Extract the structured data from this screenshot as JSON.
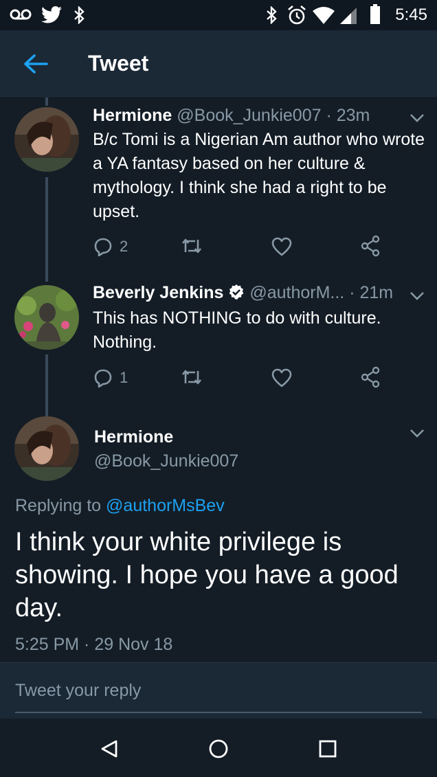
{
  "status_bar": {
    "time": "5:45",
    "icons": [
      "voicemail-icon",
      "twitter-bird-icon",
      "bluetooth-icon",
      "bluetooth-icon",
      "alarm-icon",
      "wifi-icon",
      "signal-icon",
      "battery-icon"
    ]
  },
  "header": {
    "title": "Tweet",
    "back_icon": "back-arrow-icon"
  },
  "replies": [
    {
      "name": "Hermione",
      "handle": "@Book_Junkie007",
      "time": "· 23m",
      "text": "B/c Tomi is a Nigerian Am author who wrote a YA fantasy based on her culture & mythology. I think she had a right to be upset.",
      "reply_count": "2"
    },
    {
      "name": "Beverly Jenkins",
      "verified": true,
      "handle": "@authorM...",
      "time": "· 21m",
      "text": "This has NOTHING to do with culture. Nothing.",
      "reply_count": "1"
    }
  ],
  "main_tweet": {
    "name": "Hermione",
    "handle": "@Book_Junkie007",
    "replying_prefix": "Replying to ",
    "replying_to": "@authorMsBev",
    "text": "I think your white privilege is showing. I hope you have a good day.",
    "timestamp": "5:25 PM · 29 Nov 18"
  },
  "composer": {
    "placeholder": "Tweet your reply"
  },
  "colors": {
    "background": "#141d26",
    "header": "#1b2836",
    "accent": "#1da1f2",
    "muted_text": "#8899a6"
  }
}
